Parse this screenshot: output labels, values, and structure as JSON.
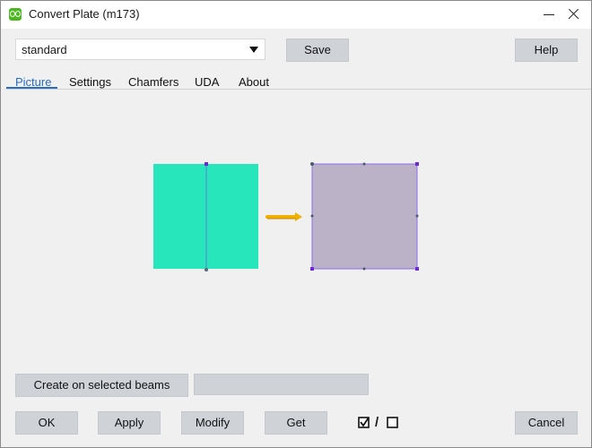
{
  "window": {
    "title": "Convert Plate (m173)"
  },
  "toolbar": {
    "preset_value": "standard",
    "save_label": "Save",
    "help_label": "Help"
  },
  "tabs": [
    {
      "label": "Picture",
      "active": true
    },
    {
      "label": "Settings",
      "active": false
    },
    {
      "label": "Chamfers",
      "active": false
    },
    {
      "label": "UDA",
      "active": false
    },
    {
      "label": "About",
      "active": false
    }
  ],
  "picture": {
    "source_shape_color": "#27e6bb",
    "result_shape_color": "#bbb2c8",
    "arrow_color": "#f0b000",
    "handle_color": "#6a2ad8"
  },
  "actions": {
    "create_label": "Create on selected beams",
    "create_field_value": ""
  },
  "footer": {
    "ok_label": "OK",
    "apply_label": "Apply",
    "modify_label": "Modify",
    "get_label": "Get",
    "toggle_separator": "/",
    "cancel_label": "Cancel"
  },
  "icons": {
    "app": "tekla-app-icon",
    "minimize": "minimize-icon",
    "close": "close-icon",
    "dropdown": "chevron-down-icon",
    "toggle_checked": "checkbox-checked-icon",
    "toggle_unchecked": "checkbox-unchecked-icon"
  }
}
